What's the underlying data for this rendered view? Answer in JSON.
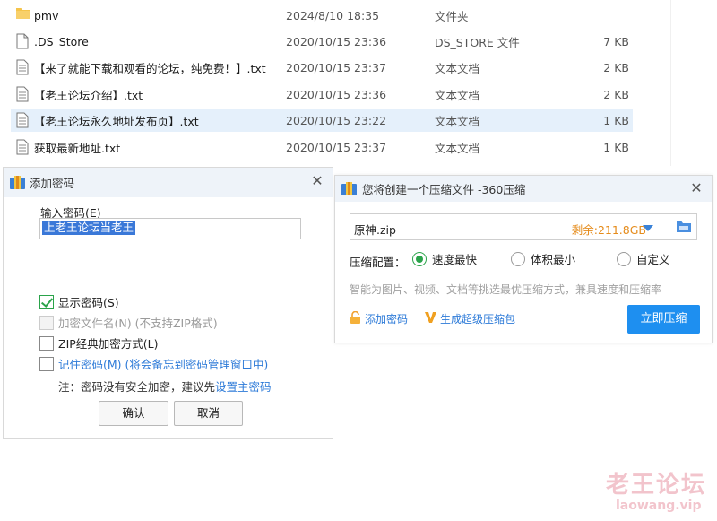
{
  "files": [
    {
      "name": "pmv",
      "date": "2024/8/10 18:35",
      "type": "文件夹",
      "size": "",
      "icon": "folder-icon"
    },
    {
      "name": ".DS_Store",
      "date": "2020/10/15 23:36",
      "type": "DS_STORE 文件",
      "size": "7 KB",
      "icon": "file-icon"
    },
    {
      "name": "【来了就能下载和观看的论坛，纯免费！】.txt",
      "date": "2020/10/15 23:37",
      "type": "文本文档",
      "size": "2 KB",
      "icon": "text-file-icon"
    },
    {
      "name": "【老王论坛介绍】.txt",
      "date": "2020/10/15 23:36",
      "type": "文本文档",
      "size": "2 KB",
      "icon": "text-file-icon"
    },
    {
      "name": "【老王论坛永久地址发布页】.txt",
      "date": "2020/10/15 23:22",
      "type": "文本文档",
      "size": "1 KB",
      "icon": "text-file-icon",
      "selected": true
    },
    {
      "name": "获取最新地址.txt",
      "date": "2020/10/15 23:37",
      "type": "文本文档",
      "size": "1 KB",
      "icon": "text-file-icon"
    }
  ],
  "password_dialog": {
    "title": "添加密码",
    "input_label": "输入密码(E)",
    "input_value": "上老王论坛当老王",
    "show_password": "显示密码(S)",
    "encrypt_filename": "加密文件名(N) (不支持ZIP格式)",
    "zip_classic": "ZIP经典加密方式(L)",
    "remember_password": "记住密码(M) (将会备忘到密码管理窗口中)",
    "note_prefix": "注：密码没有安全加密，建议先",
    "note_link": "设置主密码",
    "ok": "确认",
    "cancel": "取消"
  },
  "zip_dialog": {
    "title": "您将创建一个压缩文件 -360压缩",
    "file_name": "原神.zip",
    "free_space": "剩余:211.8GB",
    "config_label": "压缩配置：",
    "options": [
      "速度最快",
      "体积最小",
      "自定义"
    ],
    "selected_option": "速度最快",
    "hint": "智能为图片、视频、文档等挑选最优压缩方式，兼具速度和压缩率",
    "add_password": "添加密码",
    "super_package": "生成超级压缩包",
    "compress_now": "立即压缩"
  },
  "watermark": {
    "name": "老王论坛",
    "url": "laowang.vip"
  },
  "colors": {
    "accent": "#1e8ff0",
    "link": "#2e7bd8",
    "green": "#2aa34a",
    "orange": "#e58b1a",
    "selected_row": "#e5f0fb",
    "watermark": "#f2c4cc"
  }
}
